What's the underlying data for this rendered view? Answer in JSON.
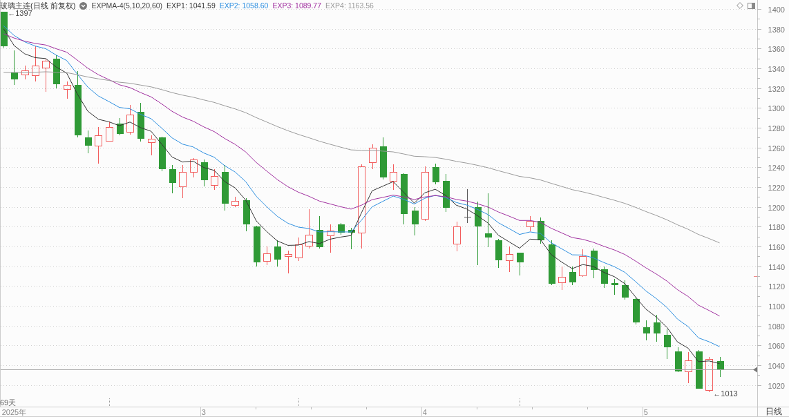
{
  "legend": {
    "title": "玻璃主连(日线 前复权)",
    "indicator": "EXPMA-4(5,10,20,60)"
  },
  "chart": {
    "span_label": "69天",
    "period": "日线",
    "chart_data": {
      "type": "candlestick",
      "grid": true,
      "categories": [
        null,
        "2025年",
        null,
        null,
        null,
        null,
        null,
        null,
        null,
        null,
        null,
        null,
        null,
        null,
        null,
        null,
        null,
        null,
        null,
        "3",
        null,
        null,
        null,
        null,
        null,
        null,
        null,
        null,
        null,
        null,
        null,
        null,
        null,
        null,
        null,
        null,
        null,
        null,
        null,
        null,
        "4",
        null,
        null,
        null,
        null,
        null,
        null,
        null,
        null,
        null,
        null,
        null,
        null,
        null,
        null,
        null,
        null,
        null,
        null,
        null,
        null,
        "5",
        null,
        null,
        null,
        null,
        null,
        null,
        null
      ],
      "ylim": [
        998.1,
        1409.07
      ],
      "yticks": [
        1020,
        1040,
        1060,
        1080,
        1100,
        1120,
        1140,
        1160,
        1180,
        1200,
        1220,
        1240,
        1260,
        1280,
        1300,
        1320,
        1340,
        1360,
        1380,
        1400
      ],
      "ohlc": [
        [
          1397,
          1397,
          1361,
          1362
        ],
        [
          1336,
          1358,
          1323,
          1329
        ],
        [
          1334,
          1343,
          1329,
          1338
        ],
        [
          1333,
          1362,
          1327,
          1343
        ],
        [
          1341,
          1349,
          1316,
          1348
        ],
        [
          1350,
          1353,
          1320,
          1324
        ],
        [
          1319,
          1327,
          1309,
          1323
        ],
        [
          1323,
          1337,
          1270,
          1272
        ],
        [
          1270,
          1277,
          1254,
          1262
        ],
        [
          1262,
          1281,
          1244,
          1272
        ],
        [
          1267,
          1286,
          1266,
          1281
        ],
        [
          1284,
          1290,
          1272,
          1274
        ],
        [
          1276,
          1303,
          1273,
          1293
        ],
        [
          1296,
          1305,
          1266,
          1269
        ],
        [
          1265,
          1272,
          1252,
          1269
        ],
        [
          1270,
          1271,
          1236,
          1238
        ],
        [
          1238,
          1242,
          1214,
          1224
        ],
        [
          1221,
          1242,
          1209,
          1235
        ],
        [
          1235,
          1249,
          1230,
          1248
        ],
        [
          1245,
          1248,
          1221,
          1227
        ],
        [
          1222,
          1238,
          1217,
          1231
        ],
        [
          1235,
          1242,
          1196,
          1203
        ],
        [
          1202,
          1210,
          1200,
          1206
        ],
        [
          1207,
          1209,
          1175,
          1182
        ],
        [
          1180,
          1181,
          1140,
          1144
        ],
        [
          1145,
          1160,
          1141,
          1153
        ],
        [
          1160,
          1166,
          1140,
          1147
        ],
        [
          1150,
          1156,
          1133,
          1152
        ],
        [
          1149,
          1169,
          1145,
          1162
        ],
        [
          1161,
          1198,
          1158,
          1172
        ],
        [
          1177,
          1191,
          1158,
          1159
        ],
        [
          1171,
          1182,
          1154,
          1176
        ],
        [
          1182,
          1184,
          1172,
          1174
        ],
        [
          1177,
          1179,
          1157,
          1174
        ],
        [
          1174,
          1243,
          1158,
          1241
        ],
        [
          1245,
          1263,
          1238,
          1260
        ],
        [
          1261,
          1270,
          1228,
          1230
        ],
        [
          1226,
          1243,
          1217,
          1235
        ],
        [
          1233,
          1234,
          1182,
          1193
        ],
        [
          1196,
          1200,
          1171,
          1182
        ],
        [
          1188,
          1241,
          1186,
          1235
        ],
        [
          1240,
          1244,
          1223,
          1225
        ],
        [
          1226,
          1233,
          1195,
          1199
        ],
        [
          1163,
          1185,
          1155,
          1180
        ],
        [
          1190,
          1218,
          1184,
          1190
        ],
        [
          1200,
          1205,
          1141,
          1180
        ],
        [
          1173,
          1214,
          1159,
          1169
        ],
        [
          1166,
          1168,
          1138,
          1146
        ],
        [
          1146,
          1160,
          1134,
          1152
        ],
        [
          1154,
          1154,
          1131,
          1144
        ],
        [
          1180,
          1191,
          1175,
          1186
        ],
        [
          1186,
          1189,
          1163,
          1166
        ],
        [
          1162,
          1166,
          1121,
          1122
        ],
        [
          1124,
          1140,
          1116,
          1129
        ],
        [
          1134,
          1140,
          1121,
          1124
        ],
        [
          1131,
          1157,
          1129,
          1150
        ],
        [
          1156,
          1158,
          1128,
          1136
        ],
        [
          1137,
          1140,
          1118,
          1122
        ],
        [
          1123,
          1127,
          1111,
          1121
        ],
        [
          1121,
          1126,
          1106,
          1108
        ],
        [
          1107,
          1109,
          1081,
          1083
        ],
        [
          1078,
          1085,
          1065,
          1072
        ],
        [
          1083,
          1091,
          1064,
          1072
        ],
        [
          1071,
          1076,
          1046,
          1058
        ],
        [
          1054,
          1058,
          1033,
          1034
        ],
        [
          1034,
          1053,
          1022,
          1045
        ],
        [
          1054,
          1055,
          1016,
          1016
        ],
        [
          1015,
          1048,
          1013,
          1046
        ],
        [
          1044,
          1048,
          1028,
          1036
        ]
      ],
      "series": [
        {
          "name": "EXP1: 1041.59",
          "type": "line",
          "color": "#333333",
          "values": [
            1380,
            1363,
            1354.7,
            1350.8,
            1349.9,
            1341.3,
            1335.2,
            1314.1,
            1296.7,
            1288.5,
            1286,
            1282,
            1285.7,
            1280.1,
            1276.4,
            1263.6,
            1250.4,
            1245.3,
            1246.2,
            1239.8,
            1236.9,
            1225.6,
            1219.1,
            1206.7,
            1185.8,
            1174.9,
            1165.6,
            1161.1,
            1161.4,
            1164.9,
            1162.9,
            1167.3,
            1169.5,
            1171,
            1194.3,
            1216.2,
            1220.8,
            1225.5,
            1214.7,
            1203.8,
            1214.2,
            1217.8,
            1211.5,
            1201.7,
            1197.8,
            1191.2,
            1183.8,
            1171.2,
            1164.8,
            1158.2,
            1167.4,
            1166.9,
            1151.9,
            1144.3,
            1137.6,
            1141.7,
            1139.9,
            1133.9,
            1129.5,
            1122.4,
            1109.2,
            1096.7,
            1088.5,
            1078.3,
            1063.5,
            1057.3,
            1043.5,
            1044.3,
            1041.6
          ]
        },
        {
          "name": "EXP2: 1058.60",
          "type": "line",
          "color": "#2e8fe0",
          "values": [
            1383,
            1373.2,
            1366.8,
            1362.5,
            1359.9,
            1353.4,
            1347.9,
            1334.1,
            1321,
            1312.1,
            1306.4,
            1300.5,
            1299.1,
            1293.6,
            1289.1,
            1279.8,
            1269.7,
            1263.4,
            1260.6,
            1254.5,
            1250.2,
            1241.6,
            1235.1,
            1225.4,
            1210.6,
            1200.1,
            1190.4,
            1183.4,
            1179.5,
            1178.1,
            1174.6,
            1174.9,
            1174.7,
            1174.6,
            1186.7,
            1200,
            1205.5,
            1210.9,
            1207.6,
            1202.9,
            1208.7,
            1211.7,
            1209.4,
            1204.4,
            1201.8,
            1197.5,
            1192.3,
            1183.9,
            1178.1,
            1172.1,
            1174.7,
            1173.1,
            1163.8,
            1157.7,
            1151.5,
            1151.3,
            1148.5,
            1143.8,
            1139.6,
            1133.9,
            1124.7,
            1115.1,
            1107.2,
            1098.3,
            1086.6,
            1079.1,
            1067.6,
            1063.7,
            1058.7
          ]
        },
        {
          "name": "EXP3: 1089.77",
          "type": "line",
          "color": "#a0309f",
          "values": [
            1375,
            1370.6,
            1367.5,
            1365.2,
            1363.6,
            1359.8,
            1356.3,
            1348.3,
            1340.1,
            1333.6,
            1328.6,
            1323.4,
            1320.5,
            1315.6,
            1311.2,
            1304.2,
            1296.6,
            1290.7,
            1286.6,
            1280.9,
            1276.1,
            1269.1,
            1263.1,
            1255.4,
            1244.8,
            1236.1,
            1227.6,
            1220.4,
            1214.8,
            1210.7,
            1205.8,
            1203,
            1200.2,
            1197.7,
            1201.8,
            1207.3,
            1209.5,
            1211.9,
            1210.1,
            1207.4,
            1210,
            1211.4,
            1210.2,
            1207.5,
            1205.8,
            1203.2,
            1199.9,
            1194.8,
            1190.7,
            1186.3,
            1186.3,
            1184.3,
            1178.4,
            1173.7,
            1169,
            1167.2,
            1164.2,
            1160.2,
            1156.5,
            1151.9,
            1145.4,
            1138.4,
            1132.1,
            1125,
            1116.3,
            1109.5,
            1100.6,
            1095.3,
            1089.7
          ]
        },
        {
          "name": "EXP4: 1163.56",
          "type": "line",
          "color": "#9a9a9a",
          "values": [
            1336,
            1335.8,
            1335.9,
            1336.1,
            1336.5,
            1336.1,
            1335.7,
            1333.6,
            1331.3,
            1329.4,
            1327.8,
            1326,
            1324.9,
            1323.1,
            1321.3,
            1318.6,
            1315.5,
            1312.9,
            1310.8,
            1308.1,
            1305.6,
            1302.2,
            1299,
            1295.2,
            1290.2,
            1285.7,
            1281.2,
            1277,
            1273.2,
            1269.9,
            1266.3,
            1263.3,
            1260.4,
            1257.6,
            1257.1,
            1257.2,
            1256.3,
            1255.6,
            1253.5,
            1251.2,
            1250.7,
            1249.9,
            1248.2,
            1246,
            1244.2,
            1242,
            1239.6,
            1236.5,
            1233.7,
            1230.8,
            1229.3,
            1227.2,
            1223.8,
            1220.7,
            1217.4,
            1215.2,
            1212.6,
            1209.6,
            1206.7,
            1203.5,
            1199.6,
            1195.3,
            1191.3,
            1186.9,
            1181.9,
            1177.4,
            1172.1,
            1168,
            1163.6
          ]
        }
      ],
      "ref_lines": [
        {
          "axis": "y",
          "value": 1036
        }
      ],
      "annotations": [
        "←1397",
        "←1013"
      ]
    }
  }
}
